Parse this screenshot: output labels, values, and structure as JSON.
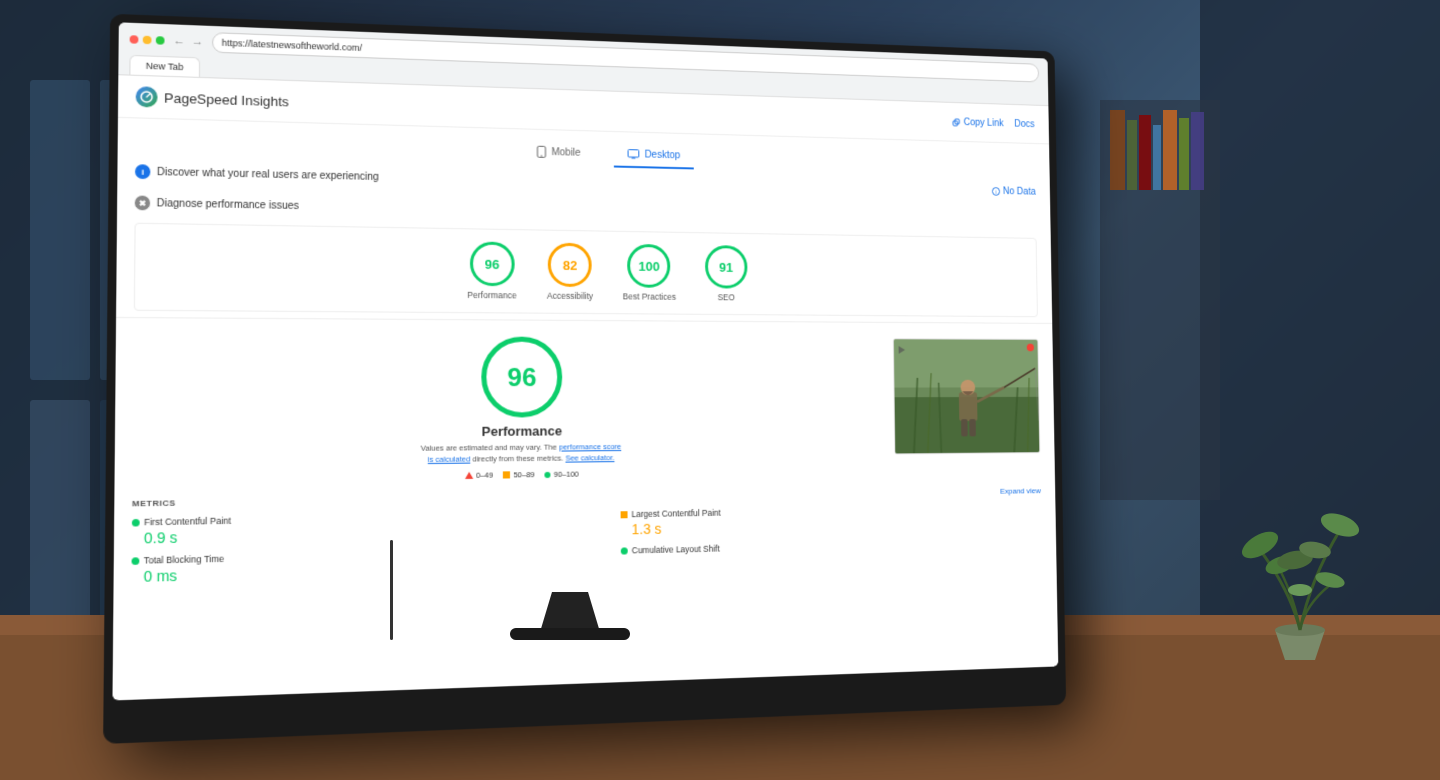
{
  "background": {
    "color": "#1a2535"
  },
  "browser": {
    "tab_title": "New Tab",
    "url": "https://latestnewsoftheworld.com/"
  },
  "header": {
    "logo_alt": "PageSpeed Insights logo",
    "title": "PageSpeed Insights",
    "copy_link_label": "Copy Link",
    "docs_label": "Docs"
  },
  "tabs": [
    {
      "id": "mobile",
      "label": "Mobile",
      "active": false
    },
    {
      "id": "desktop",
      "label": "Desktop",
      "active": true
    }
  ],
  "sections": [
    {
      "id": "real-users",
      "label": "Discover what your real users are experiencing",
      "no_data_label": "No Data"
    },
    {
      "id": "diagnose",
      "label": "Diagnose performance issues"
    }
  ],
  "scores": [
    {
      "id": "performance",
      "value": "96",
      "label": "Performance",
      "color": "green"
    },
    {
      "id": "accessibility",
      "value": "82",
      "label": "Accessibility",
      "color": "orange"
    },
    {
      "id": "best-practices",
      "value": "100",
      "label": "Best Practices",
      "color": "green"
    },
    {
      "id": "seo",
      "value": "91",
      "label": "SEO",
      "color": "green"
    }
  ],
  "performance_detail": {
    "score": "96",
    "title": "Performance",
    "note_text": "Values are estimated and may vary. The",
    "note_link1": "performance score is calculated",
    "note_mid": "directly from these metrics.",
    "note_link2": "See calculator.",
    "legend": [
      {
        "type": "triangle",
        "range": "0–49"
      },
      {
        "type": "square",
        "range": "50–89"
      },
      {
        "type": "circle",
        "range": "90–100"
      }
    ]
  },
  "metrics": {
    "label": "METRICS",
    "expand_label": "Expand view",
    "items": [
      {
        "id": "fcp",
        "name": "First Contentful Paint",
        "value": "0.9 s",
        "color": "green",
        "indicator": "circle"
      },
      {
        "id": "lcp",
        "name": "Largest Contentful Paint",
        "value": "1.3 s",
        "color": "orange",
        "indicator": "square"
      },
      {
        "id": "tbt",
        "name": "Total Blocking Time",
        "value": "0 ms",
        "color": "green",
        "indicator": "circle"
      },
      {
        "id": "cls",
        "name": "Cumulative Layout Shift",
        "value": "",
        "color": "green",
        "indicator": "circle"
      }
    ]
  }
}
